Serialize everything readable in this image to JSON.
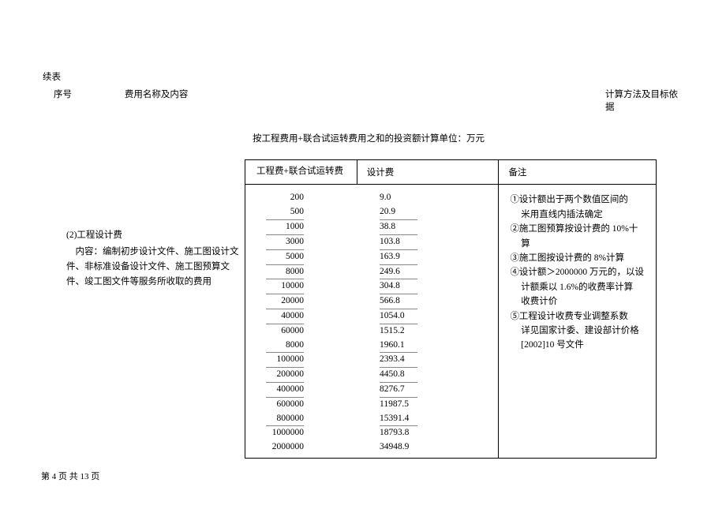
{
  "cont_label": "续表",
  "header": {
    "seq": "序号",
    "name": "费用名称及内容",
    "calc": "计算方法及目标依据"
  },
  "caption": "按工程费用+联合试运转费用之和的投资额计算单位：万元",
  "left": {
    "title": "(2)工程设计费",
    "desc": "内容：编制初步设计文件、施工图设计文件、非标准设备设计文件、施工图预算文件、竣工图文件等服务所收取的费用"
  },
  "thead": {
    "c0": "工程费+联合试运转费",
    "c1": "设计费",
    "c2": "备注"
  },
  "chart_data": {
    "type": "table",
    "title": "工程设计费",
    "columns": [
      "工程费+联合试运转费",
      "设计费"
    ],
    "groups": [
      [
        [
          "200",
          "9.0"
        ],
        [
          "500",
          "20.9"
        ]
      ],
      [
        [
          "1000",
          "38.8"
        ]
      ],
      [
        [
          "3000",
          "103.8"
        ]
      ],
      [
        [
          "5000",
          "163.9"
        ]
      ],
      [
        [
          "8000",
          "249.6"
        ]
      ],
      [
        [
          "10000",
          "304.8"
        ]
      ],
      [
        [
          "20000",
          "566.8"
        ]
      ],
      [
        [
          "40000",
          "1054.0"
        ]
      ],
      [
        [
          "60000",
          "1515.2"
        ],
        [
          "8000",
          "1960.1"
        ]
      ],
      [
        [
          "100000",
          "2393.4"
        ]
      ],
      [
        [
          "200000",
          "4450.8"
        ]
      ],
      [
        [
          "400000",
          "8276.7"
        ]
      ],
      [
        [
          "600000",
          "11987.5"
        ],
        [
          "800000",
          "15391.4"
        ]
      ],
      [
        [
          "1000000",
          "18793.8"
        ],
        [
          "2000000",
          "34948.9"
        ]
      ]
    ]
  },
  "notes": {
    "n1a": "①设计额出于两个数值区间的",
    "n1b": "米用直线内插法确定",
    "n2a": "②施工图预算按设计费的 10%十",
    "n2b": "算",
    "n3": "③施工图按设计费的 8%计算",
    "n4a": "④设计额＞2000000 万元的，以设",
    "n4b": "计额乘以 1.6%的收费率计算",
    "n4c": "收费计价",
    "n5a": "⑤工程设计收费专业调整系数",
    "n5b": "详见国家计委、建设部计价格",
    "n5c": "[2002]10 号文件"
  },
  "footer": {
    "prefix": "第 ",
    "cur": "4",
    "mid": " 页 共 ",
    "total": "13",
    "suffix": " 页"
  }
}
